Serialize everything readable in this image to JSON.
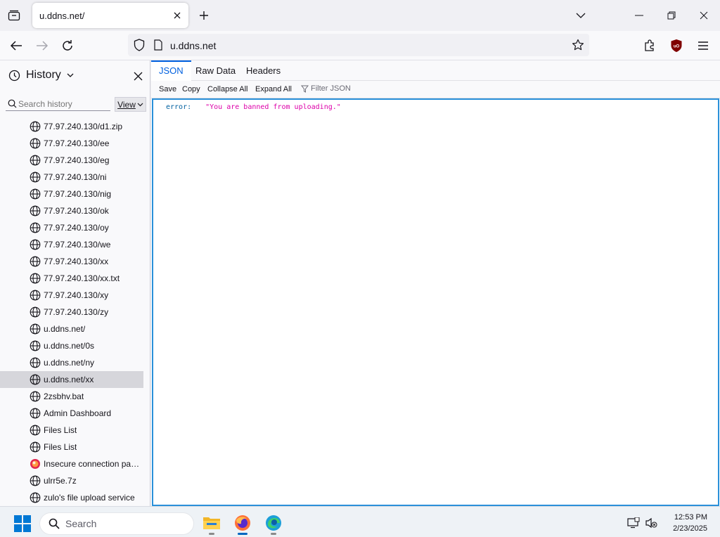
{
  "browser": {
    "tab": {
      "title": "u.ddns.net/"
    },
    "url": "u.ddns.net"
  },
  "sidebar": {
    "title": "History",
    "search_placeholder": "Search history",
    "view_label": "View",
    "items": [
      {
        "label": "77.97.240.130/d1.zip",
        "icon": "globe-icon"
      },
      {
        "label": "77.97.240.130/ee",
        "icon": "globe-icon"
      },
      {
        "label": "77.97.240.130/eg",
        "icon": "globe-icon"
      },
      {
        "label": "77.97.240.130/ni",
        "icon": "globe-icon"
      },
      {
        "label": "77.97.240.130/nig",
        "icon": "globe-icon"
      },
      {
        "label": "77.97.240.130/ok",
        "icon": "globe-icon"
      },
      {
        "label": "77.97.240.130/oy",
        "icon": "globe-icon"
      },
      {
        "label": "77.97.240.130/we",
        "icon": "globe-icon"
      },
      {
        "label": "77.97.240.130/xx",
        "icon": "globe-icon"
      },
      {
        "label": "77.97.240.130/xx.txt",
        "icon": "globe-icon"
      },
      {
        "label": "77.97.240.130/xy",
        "icon": "globe-icon"
      },
      {
        "label": "77.97.240.130/zy",
        "icon": "globe-icon"
      },
      {
        "label": "u.ddns.net/",
        "icon": "globe-icon"
      },
      {
        "label": "u.ddns.net/0s",
        "icon": "globe-icon"
      },
      {
        "label": "u.ddns.net/ny",
        "icon": "globe-icon"
      },
      {
        "label": "u.ddns.net/xx",
        "icon": "globe-icon",
        "selected": true
      },
      {
        "label": "2zsbhv.bat",
        "icon": "globe-icon"
      },
      {
        "label": "Admin Dashboard",
        "icon": "globe-icon"
      },
      {
        "label": "Files List",
        "icon": "globe-icon"
      },
      {
        "label": "Files List",
        "icon": "globe-icon"
      },
      {
        "label": "Insecure connection pass...",
        "icon": "warning-site-icon"
      },
      {
        "label": "ulrr5e.7z",
        "icon": "globe-icon"
      },
      {
        "label": "zulo's file upload service",
        "icon": "globe-icon"
      }
    ]
  },
  "json_viewer": {
    "tabs": [
      "JSON",
      "Raw Data",
      "Headers"
    ],
    "toolbar": {
      "save": "Save",
      "copy": "Copy",
      "collapse_all": "Collapse All",
      "expand_all": "Expand All",
      "filter_placeholder": "Filter JSON"
    },
    "rows": [
      {
        "key": "error:",
        "value": "\"You are banned from uploading.\""
      }
    ]
  },
  "taskbar": {
    "search_label": "Search",
    "time": "12:53 PM",
    "date": "2/23/2025"
  },
  "colors": {
    "accent": "#0060df",
    "json_key": "#0060a0",
    "json_string": "#dd00a9",
    "panel_border": "#2a90d9"
  }
}
